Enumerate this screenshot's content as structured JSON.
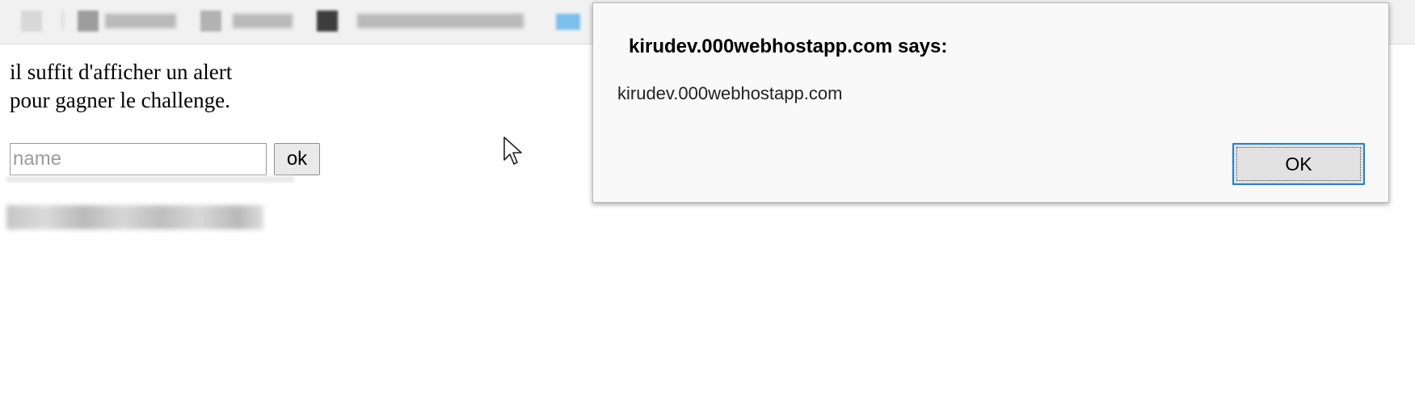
{
  "page": {
    "line1": "il suffit d'afficher un alert",
    "line2": "pour gagner le challenge.",
    "name_placeholder": "name",
    "ok_label": "ok"
  },
  "alert": {
    "title": "kirudev.000webhostapp.com says:",
    "message": "kirudev.000webhostapp.com",
    "ok_label": "OK"
  },
  "colors": {
    "dialog_background": "#f9f9f9",
    "focus_border": "#1e7fd6",
    "bookmarks_bar": "#f1f1f1"
  },
  "icons": [
    "bookmark-icon",
    "folder-icon",
    "mouse-cursor-icon"
  ]
}
